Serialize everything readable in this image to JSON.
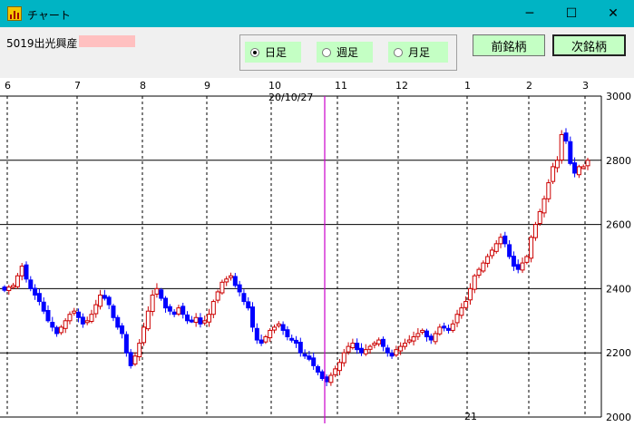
{
  "window": {
    "title": "チャート",
    "minimize": "─",
    "maximize": "☐",
    "close": "✕"
  },
  "toolbar": {
    "stock": "5019出光興産",
    "radios": [
      {
        "label": "日足",
        "selected": true
      },
      {
        "label": "週足",
        "selected": false
      },
      {
        "label": "月足",
        "selected": false
      }
    ],
    "prev_label": "前銘柄",
    "next_label": "次銘柄"
  },
  "chart_data": {
    "type": "candlestick",
    "y_ticks": [
      "3000",
      "2800",
      "2600",
      "2400",
      "2200",
      "2000"
    ],
    "ylim": [
      2000,
      3000
    ],
    "month_labels": [
      "6",
      "7",
      "8",
      "9",
      "10",
      "11",
      "12",
      "1",
      "2",
      "3"
    ],
    "cursor_date": "20/10/27",
    "year_marker": "21",
    "up_color": "#cc0000",
    "down_color": "#0000ff",
    "cursor_color": "#cc00cc",
    "close_series": [
      2395,
      2405,
      2410,
      2440,
      2470,
      2430,
      2400,
      2380,
      2360,
      2330,
      2300,
      2280,
      2260,
      2280,
      2300,
      2320,
      2330,
      2310,
      2290,
      2300,
      2320,
      2350,
      2380,
      2370,
      2350,
      2310,
      2280,
      2260,
      2200,
      2160,
      2190,
      2230,
      2280,
      2330,
      2380,
      2400,
      2370,
      2340,
      2330,
      2320,
      2340,
      2320,
      2300,
      2300,
      2310,
      2290,
      2300,
      2320,
      2360,
      2390,
      2420,
      2430,
      2440,
      2410,
      2390,
      2360,
      2340,
      2280,
      2240,
      2230,
      2250,
      2270,
      2280,
      2290,
      2270,
      2250,
      2240,
      2230,
      2200,
      2190,
      2180,
      2160,
      2140,
      2120,
      2110,
      2130,
      2150,
      2170,
      2200,
      2220,
      2230,
      2210,
      2200,
      2210,
      2220,
      2230,
      2240,
      2220,
      2200,
      2190,
      2210,
      2220,
      2230,
      2240,
      2250,
      2260,
      2270,
      2250,
      2240,
      2260,
      2280,
      2280,
      2270,
      2290,
      2320,
      2340,
      2360,
      2400,
      2440,
      2460,
      2480,
      2500,
      2520,
      2540,
      2560,
      2540,
      2500,
      2470,
      2460,
      2480,
      2500,
      2560,
      2600,
      2640,
      2680,
      2730,
      2780,
      2800,
      2880,
      2860,
      2790,
      2760,
      2780,
      2780,
      2800
    ]
  }
}
